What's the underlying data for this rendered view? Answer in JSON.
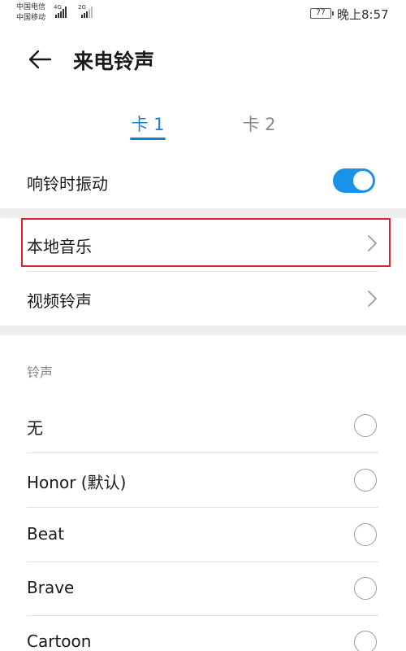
{
  "status_bar": {
    "carrier_1": "中国电信",
    "carrier_2": "中国移动",
    "signal_1": "4G",
    "signal_2": "2G",
    "battery": "77",
    "time": "晚上8:57"
  },
  "header": {
    "back_icon": "arrow-left-icon",
    "title": "来电铃声"
  },
  "tabs": [
    {
      "label": "卡 1",
      "selected": true
    },
    {
      "label": "卡 2",
      "selected": false
    }
  ],
  "vibrate": {
    "label": "响铃时振动",
    "enabled": true
  },
  "sources": [
    {
      "label": "本地音乐",
      "icon": "chevron-right-icon",
      "highlighted": true
    },
    {
      "label": "视频铃声",
      "icon": "chevron-right-icon",
      "highlighted": false
    }
  ],
  "ringtones": {
    "section_label": "铃声",
    "items": [
      {
        "label": "无",
        "selected": false
      },
      {
        "label": "Honor (默认)",
        "selected": false
      },
      {
        "label": "Beat",
        "selected": false
      },
      {
        "label": "Brave",
        "selected": false
      },
      {
        "label": "Cartoon",
        "selected": false
      }
    ]
  },
  "colors": {
    "accent": "#1282d6",
    "toggle_on": "#1b92e8",
    "highlight_box": "#d9262c"
  }
}
